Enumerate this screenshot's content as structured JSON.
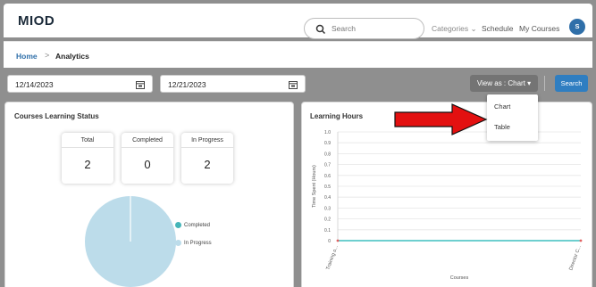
{
  "header": {
    "logo": "MIOD",
    "search_placeholder": "Search",
    "nav": {
      "categories": "Categories ⌄",
      "schedule": "Schedule",
      "my_courses": "My Courses"
    },
    "avatar_letter": "S"
  },
  "breadcrumb": {
    "home": "Home",
    "separator": ">",
    "current": "Analytics"
  },
  "filters": {
    "start_date": "12/14/2023",
    "end_date": "12/21/2023",
    "view_as_label": "View as : Chart ▾",
    "search_button": "Search"
  },
  "view_dropdown": {
    "options": [
      "Chart",
      "Table"
    ]
  },
  "courses_status": {
    "title": "Courses Learning Status",
    "stats": [
      {
        "label": "Total",
        "value": "2"
      },
      {
        "label": "Completed",
        "value": "0"
      },
      {
        "label": "In Progress",
        "value": "2"
      }
    ],
    "legend": [
      {
        "label": "Completed",
        "color": "#45b5b8"
      },
      {
        "label": "In Progress",
        "color": "#bcdcea"
      }
    ]
  },
  "chart_data": [
    {
      "type": "pie",
      "categories": [
        "Completed",
        "In Progress"
      ],
      "values": [
        0,
        2
      ],
      "colors": [
        "#45b5b8",
        "#bcdcea"
      ],
      "legend": "right"
    },
    {
      "type": "line",
      "title": "Learning Hours",
      "xlabel": "Courses",
      "ylabel": "Time Spent (Hours)",
      "categories": [
        "Training o...",
        "Director C..."
      ],
      "series": [
        {
          "values": [
            0,
            0
          ],
          "color": "#3fbfbf"
        }
      ],
      "ylim": [
        0,
        1.0
      ],
      "yticks": [
        "0",
        "0.1",
        "0.2",
        "0.3",
        "0.4",
        "0.5",
        "0.6",
        "0.7",
        "0.8",
        "0.9",
        "1.0"
      ],
      "grid": true
    }
  ],
  "colors": {
    "primary": "#2f7ec1",
    "annotation_arrow": "#e31010",
    "view_button": "#747474"
  }
}
